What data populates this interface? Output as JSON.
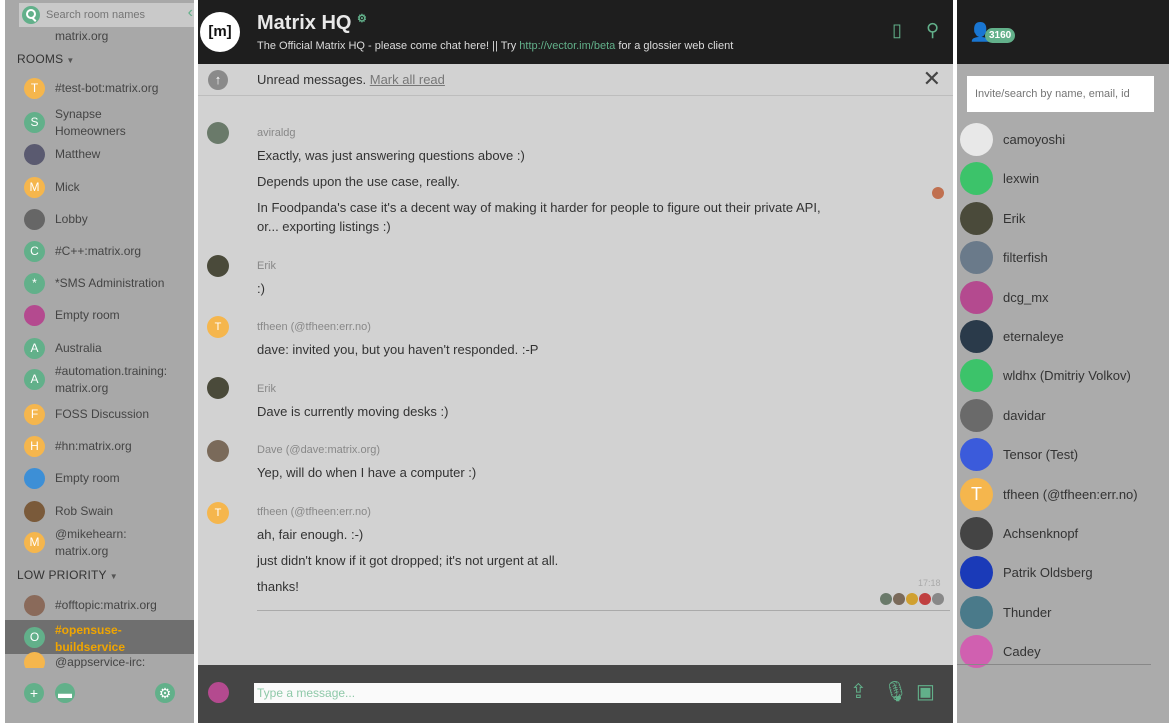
{
  "colors": {
    "accent": "#62b08a",
    "selected_room": "#f0a500",
    "header_bg": "#1e1e1e"
  },
  "left": {
    "search_placeholder": "Search room names",
    "cutoff_text": "matrix.org",
    "rooms_header": "ROOMS",
    "low_priority_header": "LOW PRIORITY",
    "rooms": [
      {
        "label": "#test-bot:matrix.org",
        "letter": "T",
        "color": "#f5b64d"
      },
      {
        "label": "Synapse Homeowners",
        "letter": "S",
        "color": "#62b08a"
      },
      {
        "label": "Matthew",
        "letter": "",
        "color": "#5a5a70"
      },
      {
        "label": "Mick",
        "letter": "M",
        "color": "#f5b64d"
      },
      {
        "label": "Lobby",
        "letter": "",
        "color": "#666666"
      },
      {
        "label": "#C++:matrix.org",
        "letter": "C",
        "color": "#62b08a"
      },
      {
        "label": "*SMS Administration",
        "letter": "*",
        "color": "#62b08a"
      },
      {
        "label": "Empty room",
        "letter": "",
        "color": "#b44a8f"
      },
      {
        "label": "Australia",
        "letter": "A",
        "color": "#62b08a"
      },
      {
        "label": "#automation.training: matrix.org",
        "letter": "A",
        "color": "#62b08a"
      },
      {
        "label": "FOSS Discussion",
        "letter": "F",
        "color": "#f5b64d"
      },
      {
        "label": "#hn:matrix.org",
        "letter": "H",
        "color": "#f5b64d"
      },
      {
        "label": "Empty room",
        "letter": "",
        "color": "#3d8fd6"
      },
      {
        "label": "Rob Swain",
        "letter": "",
        "color": "#7a5a3a"
      },
      {
        "label": "@mikehearn: matrix.org",
        "letter": "M",
        "color": "#f5b64d"
      }
    ],
    "low_priority": [
      {
        "label": "#offtopic:matrix.org",
        "letter": "",
        "color": "#8a6a5a"
      },
      {
        "label": "#opensuse-buildservice",
        "letter": "O",
        "color": "#62b08a"
      },
      {
        "label": "@appservice-irc:",
        "letter": "",
        "color": "#f5b64d"
      }
    ]
  },
  "header": {
    "logo": "[m]",
    "title": "Matrix HQ",
    "topic_pre": "The Official Matrix HQ - please come chat here! || Try ",
    "topic_link": "http://vector.im/beta",
    "topic_post": " for a glossier web client"
  },
  "unread": {
    "text": "Unread messages.",
    "link": "Mark all read"
  },
  "messages": [
    {
      "sender": "aviraldg",
      "avatar_color": "#6a7a6a",
      "letter": "",
      "lines": [
        "Exactly, was just answering questions above :)",
        "Depends upon the use case, really.",
        "In Foodpanda's case it's a decent way of making it harder for people to figure out their private API,",
        "or... exporting listings :)"
      ]
    },
    {
      "sender": "Erik",
      "avatar_color": "#4a4a3a",
      "letter": "",
      "lines": [
        ":)"
      ]
    },
    {
      "sender": "tfheen (@tfheen:err.no)",
      "avatar_color": "#f5b64d",
      "letter": "T",
      "lines": [
        "dave: invited you, but you haven't responded. :-P"
      ]
    },
    {
      "sender": "Erik",
      "avatar_color": "#4a4a3a",
      "letter": "",
      "lines": [
        "Dave is currently moving desks :)"
      ]
    },
    {
      "sender": "Dave (@dave:matrix.org)",
      "avatar_color": "#7a6a5a",
      "letter": "",
      "lines": [
        "Yep, will do when I have a computer :)"
      ]
    },
    {
      "sender": "tfheen (@tfheen:err.no)",
      "avatar_color": "#f5b64d",
      "letter": "T",
      "lines": [
        "ah, fair enough. :-)",
        "just didn't know if it got dropped; it's not urgent at all.",
        "thanks!"
      ]
    }
  ],
  "last_timestamp": "17:18",
  "composer": {
    "placeholder": "Type a message..."
  },
  "members": {
    "count": "3160",
    "invite_placeholder": "Invite/search by name, email, id",
    "list": [
      {
        "name": "camoyoshi",
        "color": "#e8e8e8",
        "letter": ""
      },
      {
        "name": "lexwin",
        "color": "#3cc36a",
        "letter": ""
      },
      {
        "name": "Erik",
        "color": "#4a4a3a",
        "letter": ""
      },
      {
        "name": "filterfish",
        "color": "#6a7a8a",
        "letter": ""
      },
      {
        "name": "dcg_mx",
        "color": "#b44a8f",
        "letter": ""
      },
      {
        "name": "eternaleye",
        "color": "#2a3a4a",
        "letter": ""
      },
      {
        "name": "wldhx (Dmitriy Volkov)",
        "color": "#3cc36a",
        "letter": ""
      },
      {
        "name": "davidar",
        "color": "#6a6a6a",
        "letter": ""
      },
      {
        "name": "Tensor (Test)",
        "color": "#3b5bdb",
        "letter": ""
      },
      {
        "name": "tfheen (@tfheen:err.no)",
        "color": "#f5b64d",
        "letter": "T"
      },
      {
        "name": "Achsenknopf",
        "color": "#444444",
        "letter": ""
      },
      {
        "name": "Patrik Oldsberg",
        "color": "#1a3ab8",
        "letter": ""
      },
      {
        "name": "Thunder",
        "color": "#4a7a8a",
        "letter": ""
      },
      {
        "name": "Cadey",
        "color": "#d060b0",
        "letter": ""
      }
    ]
  }
}
